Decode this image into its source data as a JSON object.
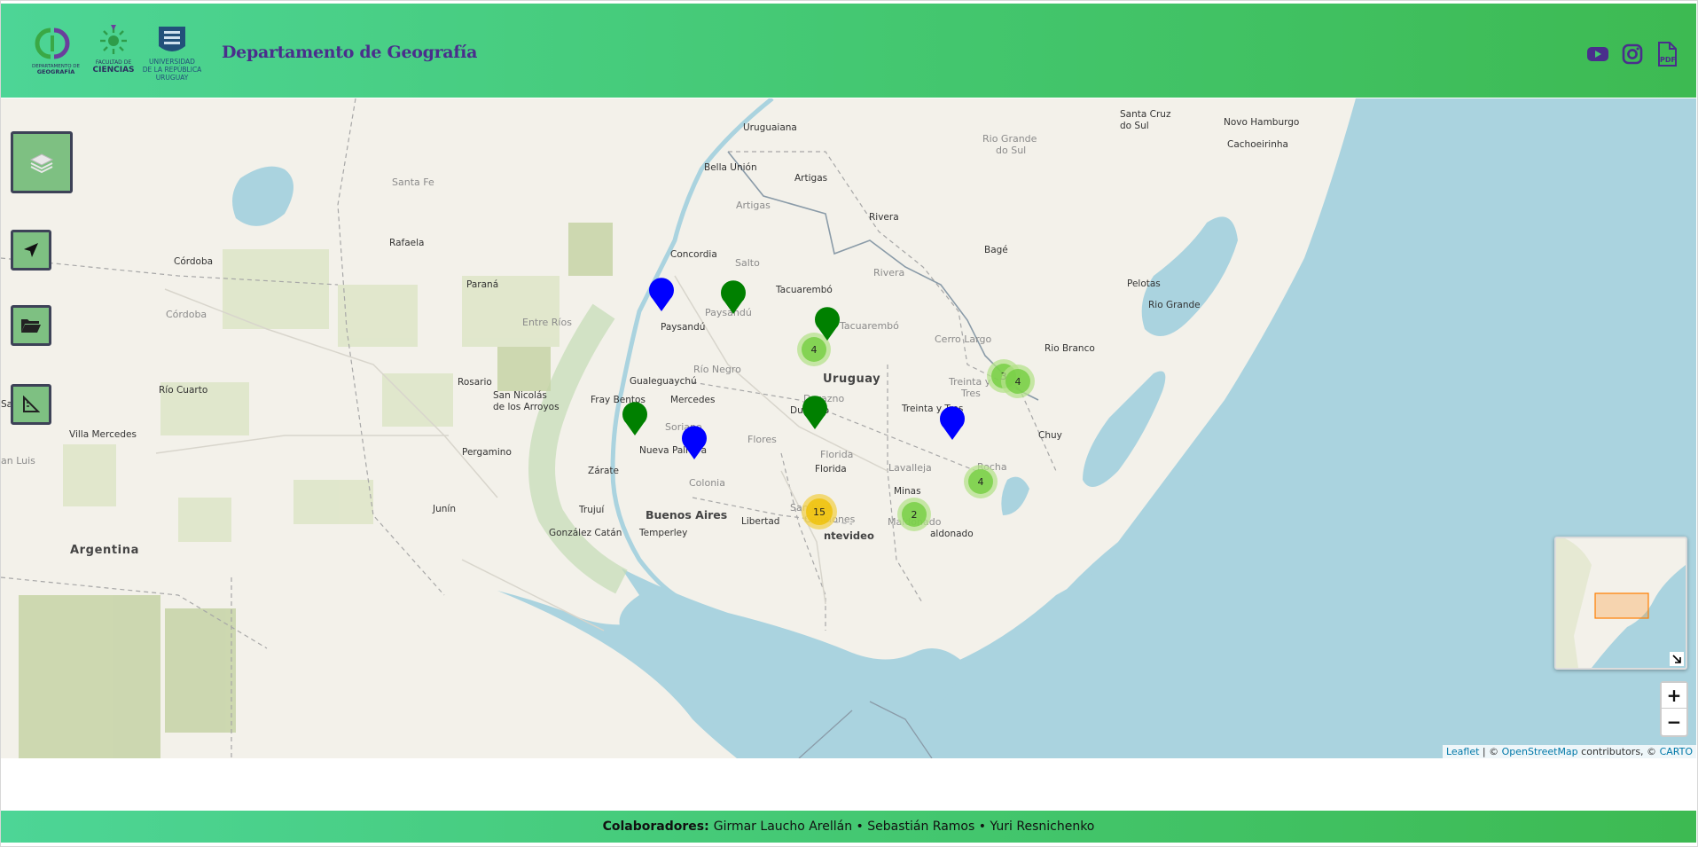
{
  "header": {
    "title": "Departamento de Geografía",
    "logos": {
      "dg_line1": "DEPARTAMENTO DE",
      "dg_line2": "GEOGRAFÍA",
      "fc_line1": "FACULTAD DE",
      "fc_line2": "CIENCIAS",
      "udelar_line1": "UNIVERSIDAD",
      "udelar_line2": "DE LA REPÚBLICA",
      "udelar_line3": "URUGUAY"
    },
    "icons": [
      "youtube-icon",
      "instagram-icon",
      "pdf-icon"
    ],
    "pdf_label": "PDF"
  },
  "map": {
    "controls": [
      "layers-icon",
      "locate-icon",
      "folder-icon",
      "measure-icon"
    ],
    "zoom_in": "+",
    "zoom_out": "−",
    "attribution": {
      "leaflet": "Leaflet",
      "sep": " | © ",
      "osm": "OpenStreetMap",
      "contributors": " contributors, © ",
      "carto": "CARTO"
    },
    "labels": {
      "uruguaiana": "Uruguaiana",
      "santa_cruz": "Santa Cruz",
      "do_sul": "do Sul",
      "novo_hamburgo": "Novo Hamburgo",
      "cachoeirinha": "Cachoeirinha",
      "rio_grande_do_sul_1": "Rio Grande",
      "rio_grande_do_sul_2": "do Sul",
      "bella_union": "Bella Unión",
      "artigas_city": "Artigas",
      "artigas_dept": "Artigas",
      "santa_fe": "Santa Fe",
      "rivera_city": "Rivera",
      "rivera_dept": "Rivera",
      "cordoba_city": "Córdoba",
      "cordoba_prov": "Córdoba",
      "rafaela": "Rafaela",
      "concordia": "Concordia",
      "salto": "Salto",
      "bage": "Bagé",
      "parana": "Paraná",
      "tacuarembo_city": "Tacuarembó",
      "tacuarembo_dept": "Tacuarembó",
      "pelotas": "Pelotas",
      "entre_rios": "Entre Ríos",
      "paysandu_dept": "Paysandú",
      "paysandu_city": "Paysandú",
      "rio_grande": "Rio Grande",
      "cerro_largo": "Cerro Largo",
      "rio_negro": "Río Negro",
      "uruguay": "Uruguay",
      "rio_branco": "Rio Branco",
      "rosario": "Rosario",
      "gualeguaychu": "Gualeguaychú",
      "durazno_dept": "Durazno",
      "treinta_y_tres_dept_1": "Treinta y",
      "treinta_y_tres_dept_2": "Tres",
      "rio_cuarto": "Río Cuarto",
      "san_nicolas_1": "San Nicolás",
      "san_nicolas_2": "de los Arroyos",
      "fray_bentos": "Fray Bentos",
      "mercedes": "Mercedes",
      "durazno_city": "Durazno",
      "treinta_y_tres_city": "Treinta y Tres",
      "san_luis_city": "San Luis",
      "soriano": "Soriano",
      "villa_mercedes": "Villa Mercedes",
      "flores": "Flores",
      "chuy": "Chuy",
      "nueva_palmira": "Nueva Palmira",
      "florida_dept": "Florida",
      "san_luis_prov": "an Luis",
      "pergamino": "Pergamino",
      "rocha": "Rocha",
      "lavalleja": "Lavalleja",
      "zarate": "Zárate",
      "florida_city": "Florida",
      "colonia": "Colonia",
      "minas": "Minas",
      "junin": "Junín",
      "san_jose": "San José",
      "trujui": "Trujuí",
      "buenos_aires": "Buenos Aires",
      "canelones": "Canelones",
      "libertad": "Libertad",
      "maldonado_dept": "Maldonado",
      "gonzalez_catan": "González Catán",
      "temperley": "Temperley",
      "montevideo": "ntevideo",
      "maldonado_city": "aldonado",
      "argentina": "Argentina"
    },
    "clusters": [
      {
        "count": "4",
        "level": "small"
      },
      {
        "count": "3",
        "level": "small"
      },
      {
        "count": "4",
        "level": "small"
      },
      {
        "count": "4",
        "level": "small"
      },
      {
        "count": "15",
        "level": "medium"
      },
      {
        "count": "2",
        "level": "small"
      }
    ],
    "markers": [
      "blue",
      "green",
      "green",
      "green",
      "green",
      "blue",
      "blue"
    ],
    "colors": {
      "water": "#aad3df",
      "land": "#f3f1ea",
      "marker_blue": "#0000ff",
      "marker_green": "#008000",
      "cluster_small": "#b5e28c",
      "cluster_small_inner": "#6ecc39",
      "cluster_medium": "#f1d357",
      "cluster_medium_inner": "#f0c20c",
      "header_start": "#4dd596",
      "header_end": "#3dba52",
      "title": "#4a2e8c"
    }
  },
  "footer": {
    "label": "Colaboradores:",
    "names": "Girmar Laucho Arellán • Sebastián Ramos • Yuri Resnichenko"
  }
}
